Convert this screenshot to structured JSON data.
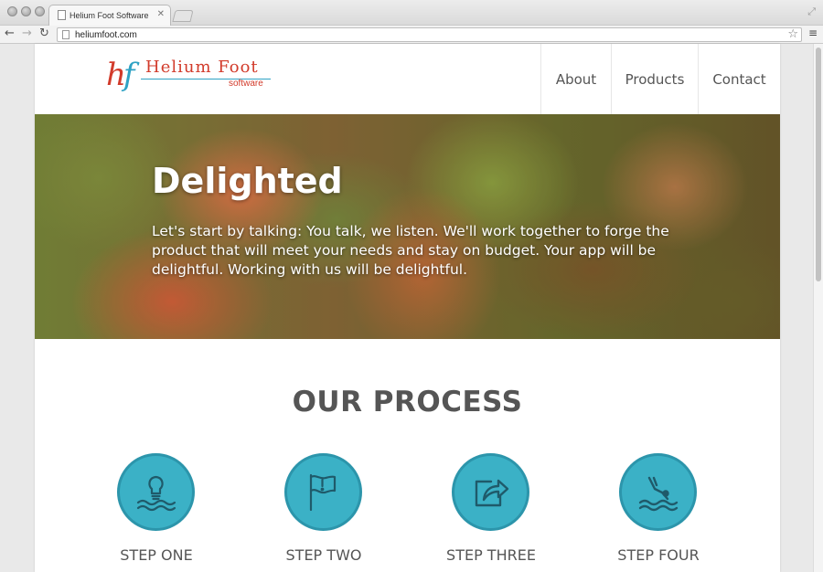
{
  "browser": {
    "tab_title": "Helium Foot Software",
    "url": "heliumfoot.com"
  },
  "logo": {
    "mark_h": "h",
    "mark_f": "f",
    "name": "Helium Foot",
    "tagline": "software"
  },
  "nav": {
    "about": "About",
    "products": "Products",
    "contact": "Contact"
  },
  "hero": {
    "title": "Delighted",
    "text": "Let's start by talking: You talk, we listen. We'll work together to forge the product that will meet your needs and stay on budget. Your app will be delightful. Working with us will be delightful."
  },
  "process": {
    "title": "OUR PROCESS",
    "steps": [
      {
        "label": "STEP ONE",
        "icon": "lightbulb-icon"
      },
      {
        "label": "STEP TWO",
        "icon": "flag-icon"
      },
      {
        "label": "STEP THREE",
        "icon": "share-icon"
      },
      {
        "label": "STEP FOUR",
        "icon": "diver-icon"
      }
    ]
  },
  "colors": {
    "brand_red": "#d23b2b",
    "brand_blue": "#2fa2c4",
    "step_circle": "#3bb1c6",
    "step_icon": "#1f5a6a",
    "nav_text": "#555555"
  }
}
